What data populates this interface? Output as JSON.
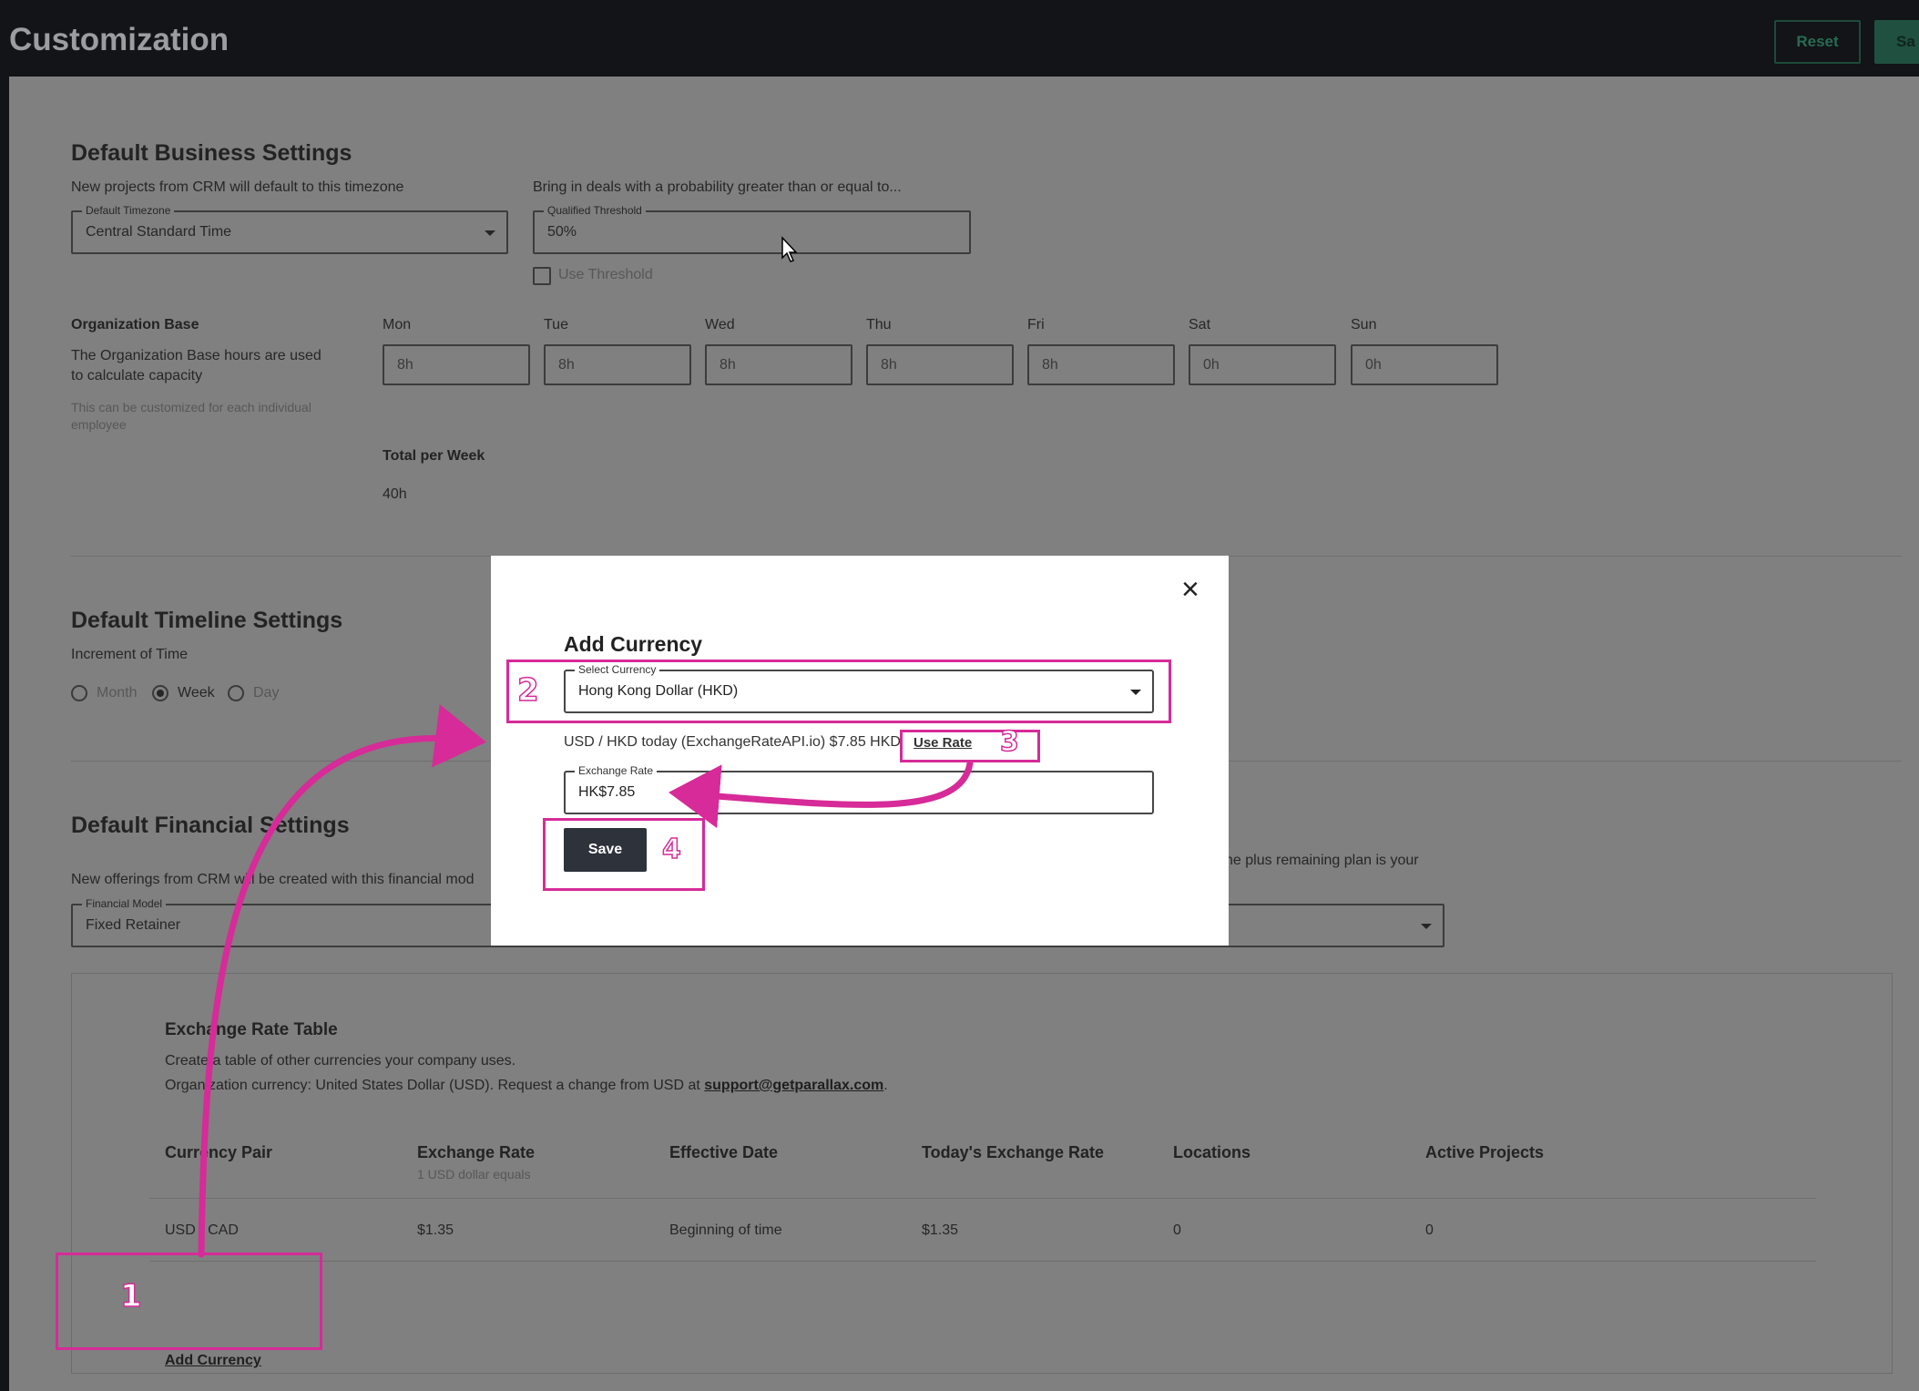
{
  "header": {
    "title": "Customization",
    "reset_label": "Reset",
    "save_label": "Sa"
  },
  "business": {
    "title": "Default Business Settings",
    "timezone_desc": "New projects from CRM will default to this timezone",
    "timezone_label": "Default Timezone",
    "timezone_value": "Central Standard Time",
    "threshold_desc": "Bring in deals with a probability greater than or equal to...",
    "threshold_label": "Qualified Threshold",
    "threshold_value": "50%",
    "use_threshold_label": "Use Threshold",
    "org_base_title": "Organization Base",
    "org_base_desc_1": "The Organization Base hours are used",
    "org_base_desc_2": "to calculate capacity",
    "org_base_note_1": "This can be customized for each individual",
    "org_base_note_2": "employee",
    "days": [
      {
        "label": "Mon",
        "value": "8h"
      },
      {
        "label": "Tue",
        "value": "8h"
      },
      {
        "label": "Wed",
        "value": "8h"
      },
      {
        "label": "Thu",
        "value": "8h"
      },
      {
        "label": "Fri",
        "value": "8h"
      },
      {
        "label": "Sat",
        "value": "0h"
      },
      {
        "label": "Sun",
        "value": "0h"
      }
    ],
    "total_label": "Total per Week",
    "total_value": "40h"
  },
  "timeline": {
    "title": "Default Timeline Settings",
    "increment_label": "Increment of Time",
    "options": [
      "Month",
      "Week",
      "Day"
    ],
    "selected": "Week"
  },
  "financial": {
    "title": "Default Financial Settings",
    "desc": "New offerings from CRM will be created with this financial mod",
    "desc_right": "ne plus remaining plan is your",
    "model_label": "Financial Model",
    "model_value": "Fixed Retainer"
  },
  "exchange_table": {
    "title": "Exchange Rate Table",
    "desc": "Create a table of other currencies your company uses.",
    "org_currency_text": "Organization currency: United States Dollar (USD). Request a change from USD at ",
    "support_email": "support@getparallax.com",
    "period": ".",
    "columns": [
      "Currency Pair",
      "Exchange Rate",
      "Effective Date",
      "Today's Exchange Rate",
      "Locations",
      "Active Projects"
    ],
    "rate_sub": "1 USD dollar equals",
    "rows": [
      {
        "pair": "USD / CAD",
        "rate": "$1.35",
        "effective": "Beginning of time",
        "today": "$1.35",
        "locations": "0",
        "projects": "0"
      }
    ],
    "add_label": "Add Currency"
  },
  "modal": {
    "title": "Add Currency",
    "select_label": "Select Currency",
    "select_value": "Hong Kong Dollar (HKD)",
    "rate_info": "USD / HKD today (ExchangeRateAPI.io) $7.85 HKD",
    "use_rate_label": "Use Rate",
    "rate_field_label": "Exchange Rate",
    "rate_field_value": "HK$7.85",
    "save_label": "Save",
    "close_icon": "×"
  },
  "annotations": {
    "n1": "1",
    "n2": "2",
    "n3": "3",
    "n4": "4"
  },
  "colors": {
    "accent": "#d62b98",
    "overlay": "#808080",
    "dark_button": "#2d323b"
  }
}
